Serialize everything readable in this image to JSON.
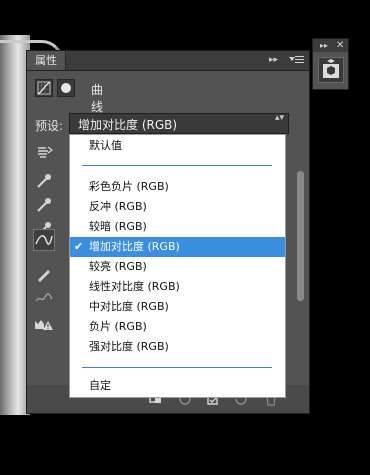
{
  "panel": {
    "tab_label": "属性",
    "collapse_glyph": "▸▸",
    "adjustment_title": "曲线",
    "preset_label": "预设:",
    "preset_value": "增加对比度 (RGB)",
    "select_arrows": "▴▾"
  },
  "mini_panel": {
    "collapse_glyph": "▸▸",
    "close_glyph": "✕"
  },
  "dropdown": {
    "default_item": "默认值",
    "items": [
      "彩色负片 (RGB)",
      "反冲 (RGB)",
      "较暗 (RGB)",
      "增加对比度 (RGB)",
      "较亮 (RGB)",
      "线性对比度 (RGB)",
      "中对比度 (RGB)",
      "负片 (RGB)",
      "强对比度 (RGB)"
    ],
    "selected_index": 3,
    "check_glyph": "✔",
    "custom_item": "自定"
  },
  "colors": {
    "panel": "#535353",
    "selection": "#3b8ee0",
    "separator": "#3a87c8"
  },
  "icons": {
    "sidebar": [
      "on-image-adjust-icon",
      "eyedropper-black-icon",
      "eyedropper-gray-icon",
      "eyedropper-white-icon",
      "curve-edit-icon",
      "pencil-icon",
      "smooth-icon",
      "clipping-warning-icon"
    ],
    "footer": [
      "clip-to-layer-icon",
      "view-previous-icon",
      "reset-icon",
      "visibility-icon",
      "delete-icon"
    ]
  }
}
